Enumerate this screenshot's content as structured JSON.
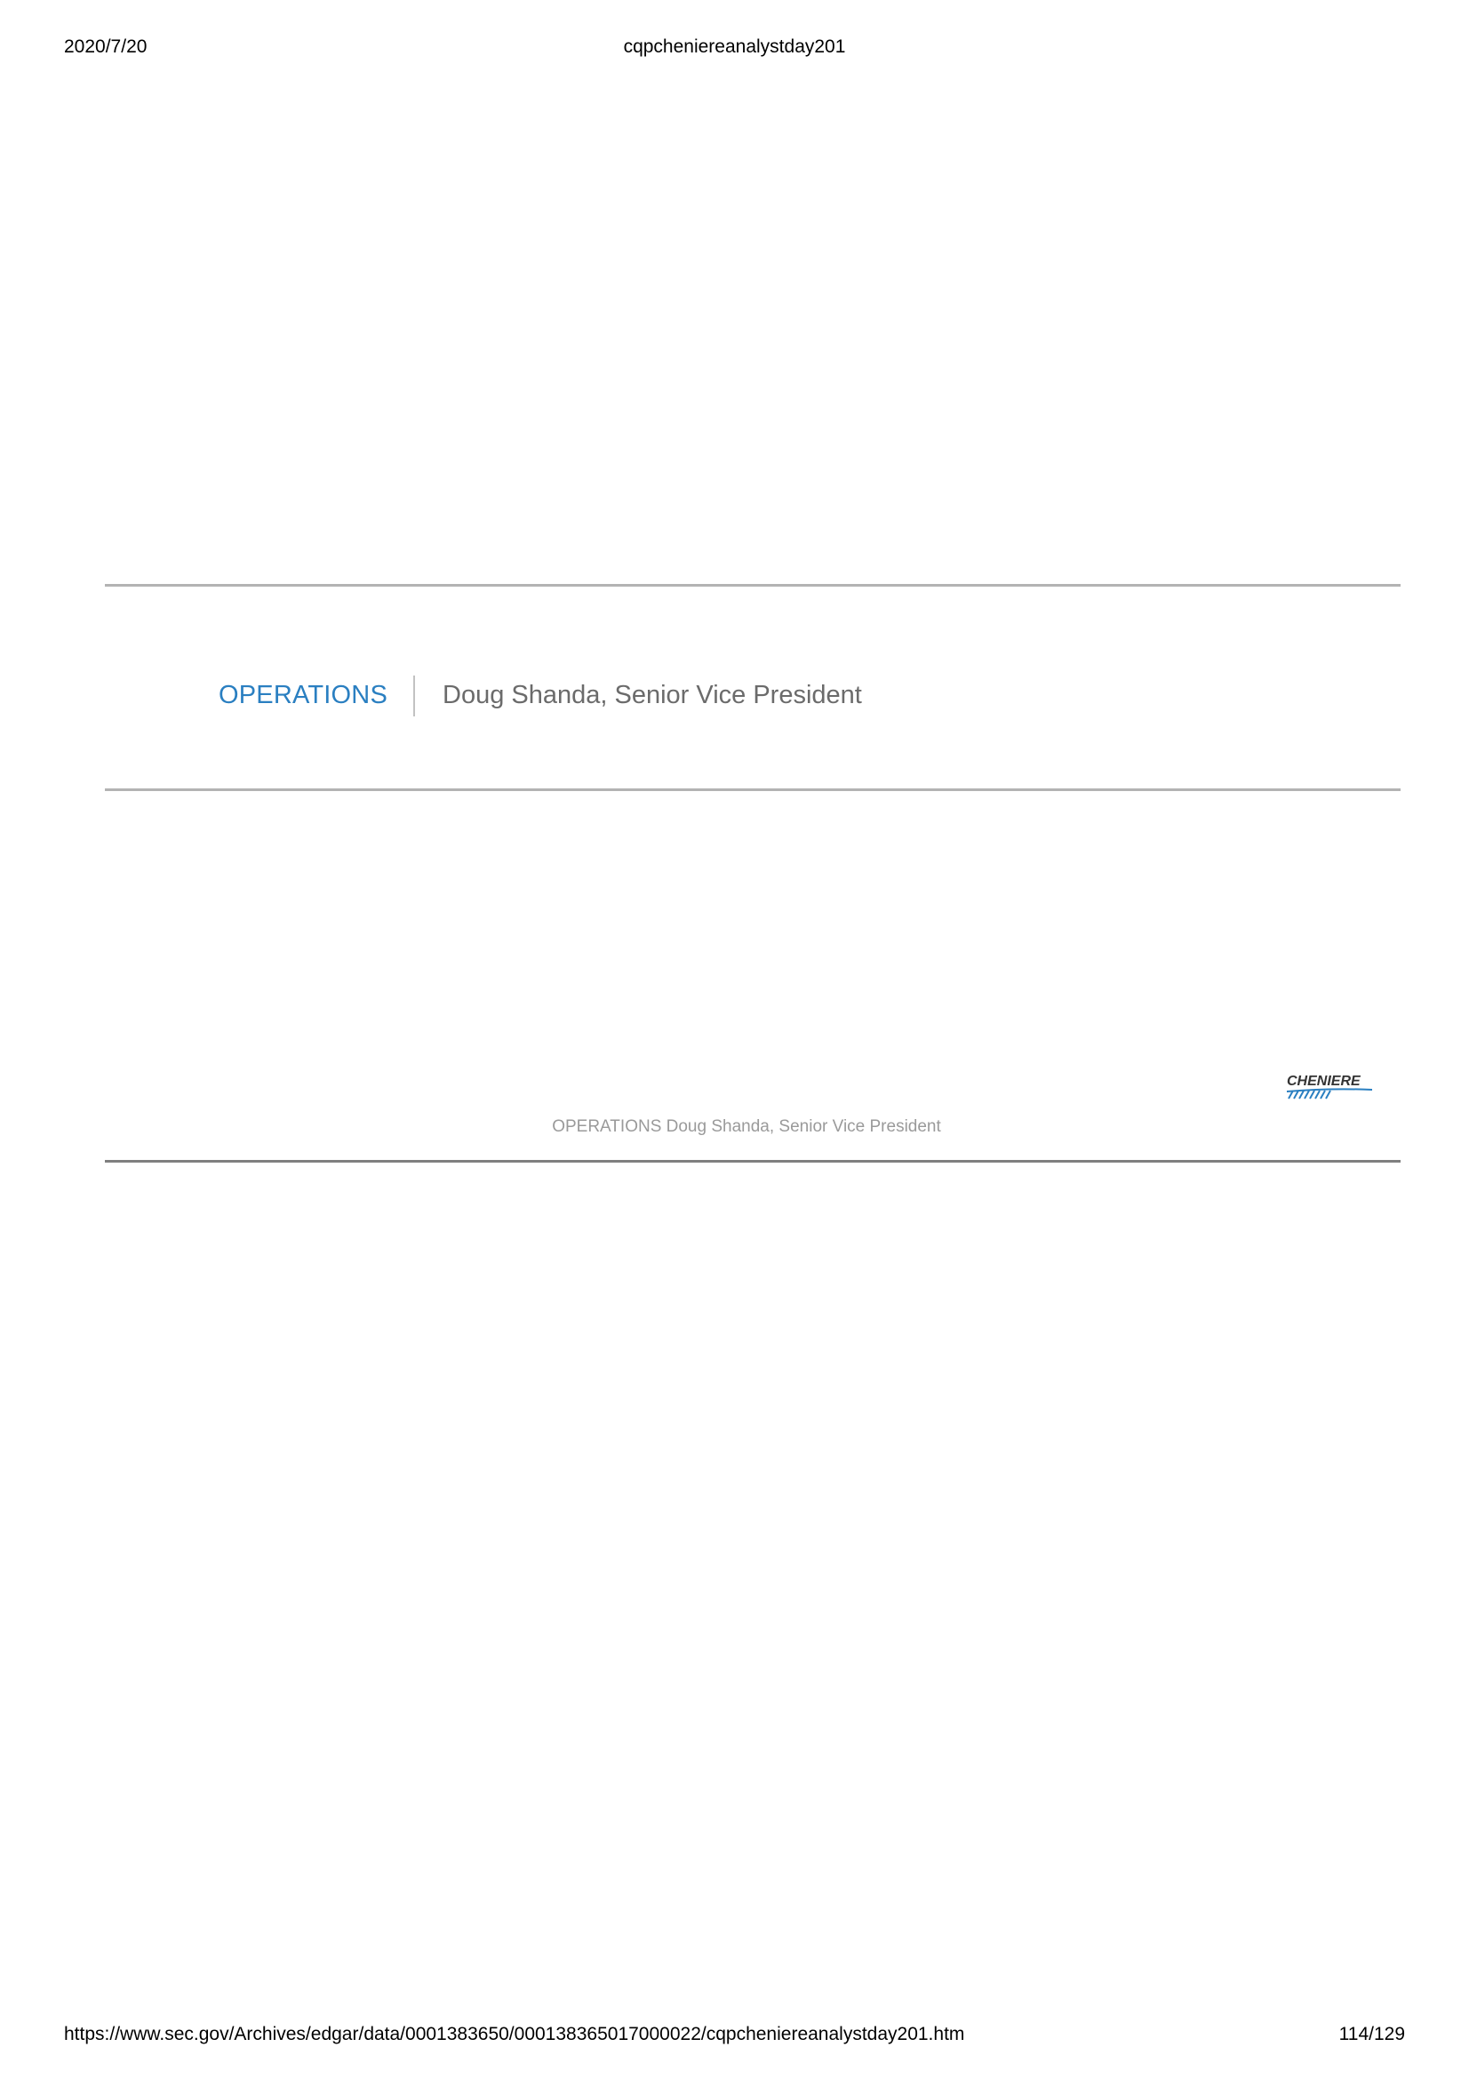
{
  "print_header": {
    "date": "2020/7/20",
    "title": "cqpcheniereanalystday201"
  },
  "slide": {
    "section": "OPERATIONS",
    "presenter": "Doug Shanda, Senior Vice President",
    "caption": "OPERATIONS Doug Shanda, Senior Vice President",
    "logo_text": "CHENIERE",
    "colors": {
      "section_blue": "#2a7fc1",
      "presenter_gray": "#6b6b6b",
      "rule_gray": "#b3b3b3",
      "logo_blue": "#2a7fc1"
    }
  },
  "print_footer": {
    "url": "https://www.sec.gov/Archives/edgar/data/0001383650/000138365017000022/cqpcheniereanalystday201.htm",
    "page": "114/129"
  }
}
